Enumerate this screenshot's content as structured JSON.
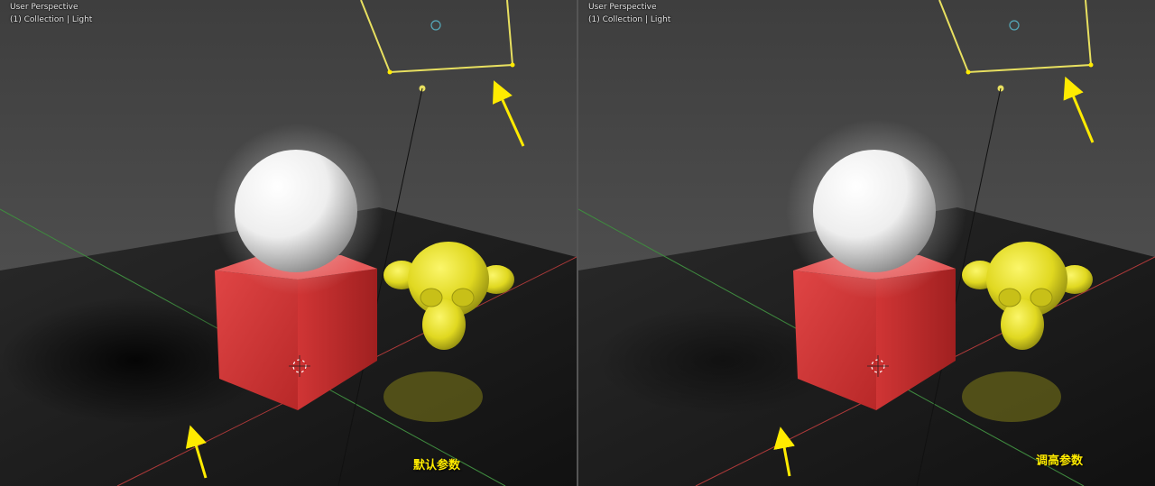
{
  "viewports": [
    {
      "mode_label": "User Perspective",
      "collection_label": "(1) Collection | Light",
      "caption": "默认参数"
    },
    {
      "mode_label": "User Perspective",
      "collection_label": "(1) Collection | Light",
      "caption": "调高参数"
    }
  ],
  "colors": {
    "background": "#4a4a4a",
    "floor": "#151515",
    "cube": "#d83a3a",
    "monkey": "#e4e020",
    "light_outline": "#e8e060",
    "annotation": "#ffeb00",
    "axis_x": "#b03a3a",
    "axis_y": "#3f8a3f"
  }
}
